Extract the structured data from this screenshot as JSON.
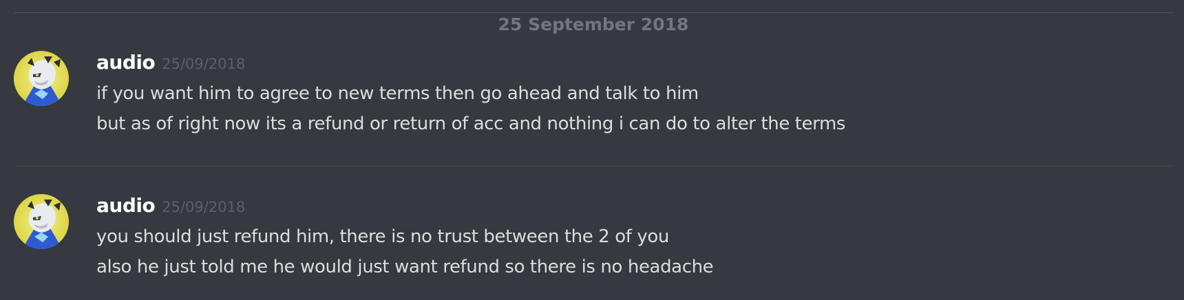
{
  "date_divider": "25 September 2018",
  "messages": [
    {
      "author": "audio",
      "timestamp": "25/09/2018",
      "avatar_icon": "robot-warrior-avatar",
      "lines": [
        "if you want him to agree to new terms then go ahead and talk to him",
        "but as of right now its a refund or return of acc and nothing i can do to alter the terms"
      ]
    },
    {
      "author": "audio",
      "timestamp": "25/09/2018",
      "avatar_icon": "robot-warrior-avatar",
      "lines": [
        "you should just refund him, there is no trust between the 2 of you",
        "also he just told me he would just want refund so there is no headache"
      ]
    }
  ],
  "colors": {
    "background": "#36393f",
    "username": "#ffffff",
    "message_text": "#dcddde",
    "timestamp": "#5c6067",
    "divider": "#4f545c"
  }
}
